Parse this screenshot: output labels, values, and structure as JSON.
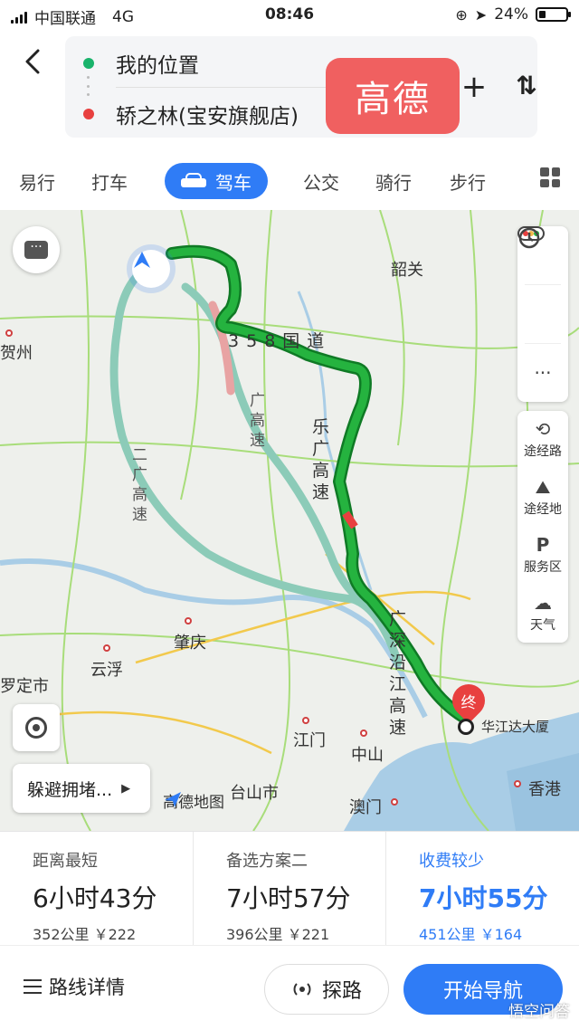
{
  "statusbar": {
    "carrier": "中国联通",
    "network": "4G",
    "time": "08:46",
    "battery": "24%",
    "battery_level": 0.24
  },
  "header": {
    "origin": "我的位置",
    "destination": "轿之林(宝安旗舰店)",
    "watermark": "高德",
    "origin_color": "#19b36b",
    "destination_color": "#e8403f"
  },
  "tabs": [
    {
      "label": "易行"
    },
    {
      "label": "打车"
    },
    {
      "label": "驾车",
      "active": true
    },
    {
      "label": "公交"
    },
    {
      "label": "骑行"
    },
    {
      "label": "步行"
    }
  ],
  "map": {
    "labels": {
      "shaoguan": "韶关",
      "hezhou": "贺州",
      "zhaoqing": "肇庆",
      "yunfu": "云浮",
      "luoding": "罗定市",
      "jiangmen": "江门",
      "zhongshan": "中山",
      "macau": "澳门",
      "hongkong": "香港",
      "taishan": "台山市",
      "destination": "华江达大厦",
      "end_marker": "终"
    },
    "route_labels": [
      "3",
      "5",
      "8",
      "国",
      "道",
      "乐",
      "广",
      "高",
      "速",
      "广",
      "深",
      "沿",
      "江",
      "高",
      "速",
      "二",
      "广",
      "高",
      "速",
      "广",
      "高",
      "速"
    ],
    "right_panel": {
      "traffic": "traffic-icon",
      "history": "history-icon",
      "more": "···",
      "waypoint": "途经路",
      "waypoint_area": "途经地",
      "service": "服务区",
      "weather": "天气"
    },
    "avoid_label": "躲避拥堵...",
    "brand": "高德地图",
    "colors": {
      "route_main": "#25b33f",
      "route_alt": "#8ccbb8",
      "route_border": "#0f7a25",
      "water": "#a9cde6"
    }
  },
  "plans": [
    {
      "name": "距离最短",
      "duration": "6小时43分",
      "meta": "352公里  ￥222"
    },
    {
      "name": "备选方案二",
      "duration": "7小时57分",
      "meta": "396公里  ￥221"
    },
    {
      "name": "收费较少",
      "duration": "7小时55分",
      "meta": "451公里  ￥164",
      "active": true
    }
  ],
  "bottom": {
    "detail": "路线详情",
    "explore": "探路",
    "start": "开始导航",
    "watermark": "悟空问答"
  }
}
